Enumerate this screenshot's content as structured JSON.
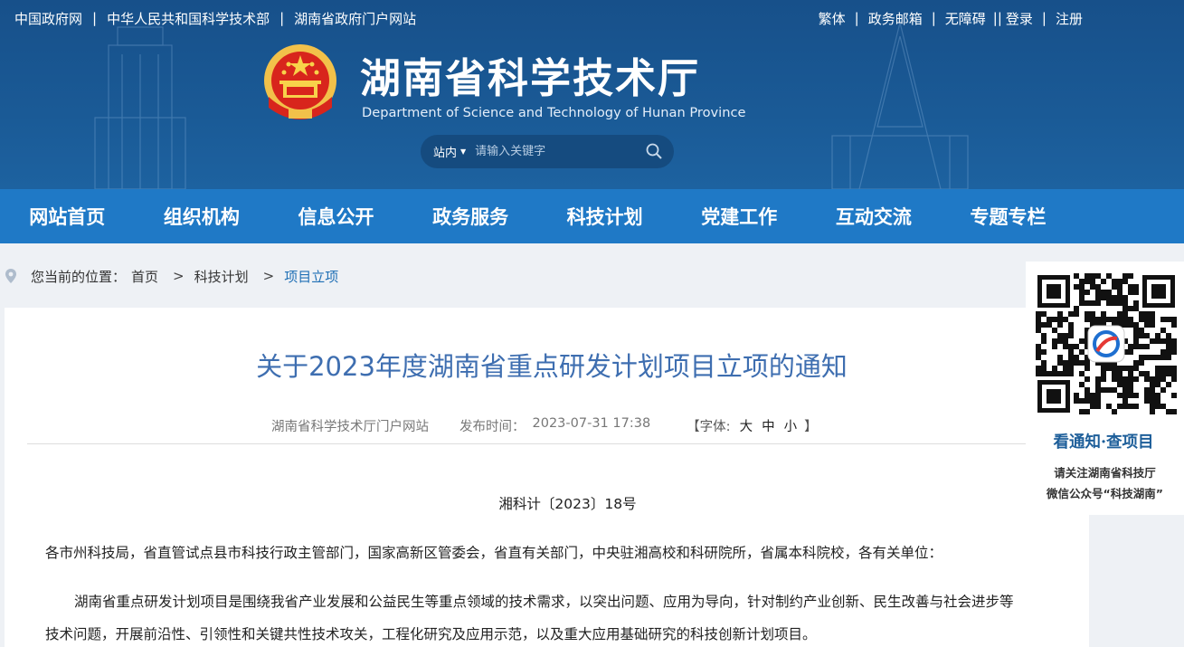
{
  "colors": {
    "header_bg": "#1a5a96",
    "nav_bg": "#1f79c6",
    "title": "#3e6eb0",
    "crumb_current": "#1f6fb5"
  },
  "top_links": [
    "中国政府网",
    "中华人民共和国科学技术部",
    "湖南省政府门户网站"
  ],
  "right_links": {
    "traditional": "繁体",
    "mail": "政务邮箱",
    "accessibility": "无障碍",
    "login": "登录",
    "register": "注册"
  },
  "site": {
    "title": "湖南省科学技术厅",
    "subtitle": "Department of Science and Technology of Hunan Province"
  },
  "search": {
    "scope": "站内",
    "placeholder": "请输入关键字",
    "icon": "search-icon"
  },
  "nav": [
    "网站首页",
    "组织机构",
    "信息公开",
    "政务服务",
    "科技计划",
    "党建工作",
    "互动交流",
    "专题专栏"
  ],
  "breadcrumb": {
    "prefix": "您当前的位置：",
    "items": [
      "首页",
      "科技计划",
      "项目立项"
    ]
  },
  "article": {
    "title": "关于2023年度湖南省重点研发计划项目立项的通知",
    "source": "湖南省科学技术厅门户网站",
    "date_label": "发布时间：",
    "date": "2023-07-31 17:38",
    "font_label": "【字体:",
    "font_sizes": [
      "大",
      "中",
      "小"
    ],
    "font_close": "】",
    "doc_no": "湘科计〔2023〕18号",
    "paragraphs": [
      "各市州科技局，省直管试点县市科技行政主管部门，国家高新区管委会，省直有关部门，中央驻湘高校和科研院所，省属本科院校，各有关单位：",
      "湖南省重点研发计划项目是围绕我省产业发展和公益民生等重点领域的技术需求，以突出问题、应用为导向，针对制约产业创新、民生改善与社会进步等",
      "技术问题，开展前沿性、引领性和关键共性技术攻关，工程化研究及应用示范，以及重大应用基础研究的科技创新计划项目。"
    ]
  },
  "qr": {
    "caption": "看通知·查项目",
    "line1": "请关注湖南省科技厅",
    "line2": "微信公众号“科技湖南”"
  }
}
